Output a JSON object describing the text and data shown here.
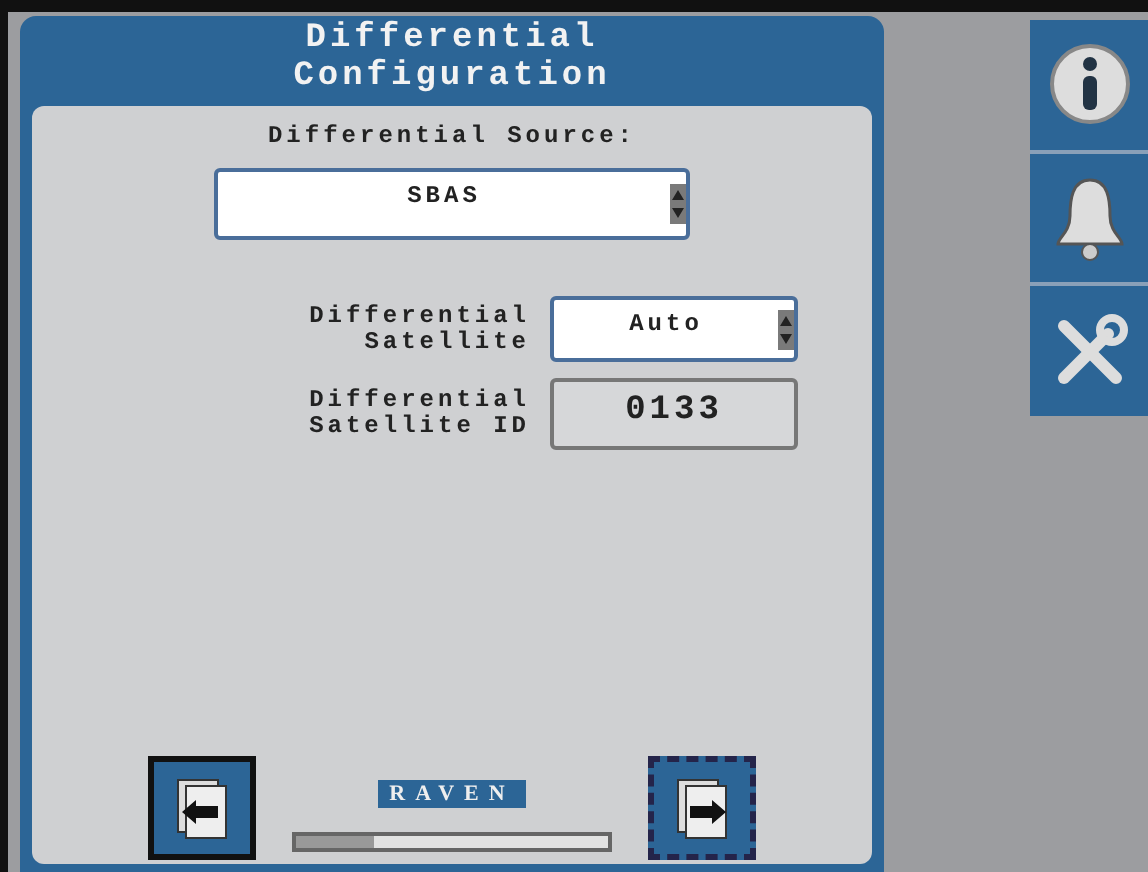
{
  "window": {
    "title": "Differential\nConfiguration"
  },
  "source": {
    "label": "Differential Source:",
    "value": "SBAS"
  },
  "fields": [
    {
      "kind": "select",
      "label": "Differential\nSatellite",
      "value": "Auto"
    },
    {
      "kind": "readout",
      "label": "Differential\nSatellite ID",
      "value": "0133"
    }
  ],
  "footer": {
    "logo": "RAVEN",
    "progress": {
      "level": 0.25
    },
    "buttons": [
      {
        "kind": "back",
        "focused": false
      },
      {
        "kind": "next",
        "focused": true
      }
    ]
  },
  "sidebar": {
    "items": [
      {
        "kind": "info"
      },
      {
        "kind": "alarm"
      },
      {
        "kind": "tools"
      }
    ]
  }
}
